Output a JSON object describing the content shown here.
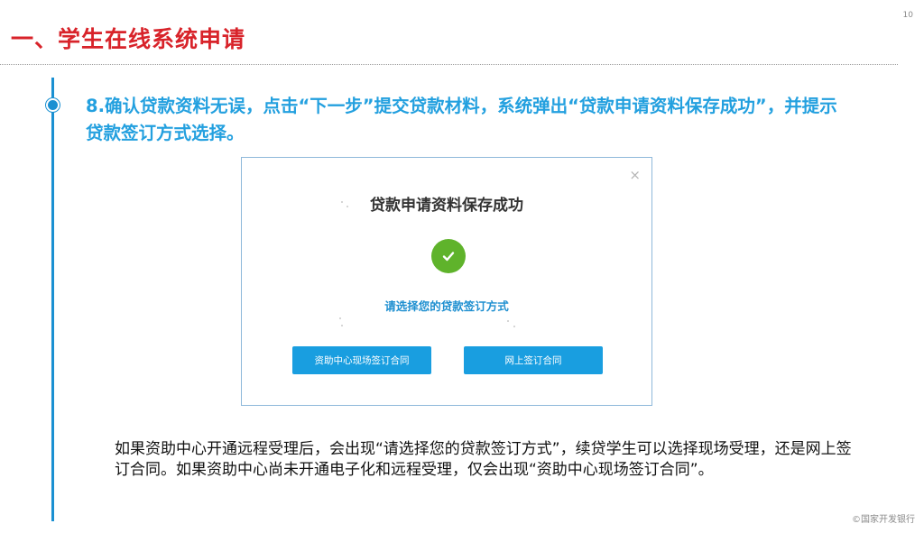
{
  "page_number": "10",
  "section_title": "一、学生在线系统申请",
  "step_text": "8.确认贷款资料无误，点击“下一步”提交贷款材料，系统弹出“贷款申请资料保存成功”，并提示贷款签订方式选择。",
  "dialog": {
    "close_glyph": "×",
    "title": "贷款申请资料保存成功",
    "prompt": "请选择您的贷款签订方式",
    "buttons": {
      "onsite": "资助中心现场签订合同",
      "online": "网上签订合同"
    },
    "success_color": "#5fb32b",
    "button_color": "#199ee0",
    "success_icon": "check-icon"
  },
  "explanation": "如果资助中心开通远程受理后，会出现“请选择您的贷款签订方式”，续贷学生可以选择现场受理，还是网上签订合同。如果资助中心尚未开通电子化和远程受理，仅会出现“资助中心现场签订合同”。",
  "footer_mark": "©国家开发银行",
  "colors": {
    "title_red": "#d8232a",
    "accent_blue": "#1a90d2",
    "step_blue": "#23a0df"
  }
}
